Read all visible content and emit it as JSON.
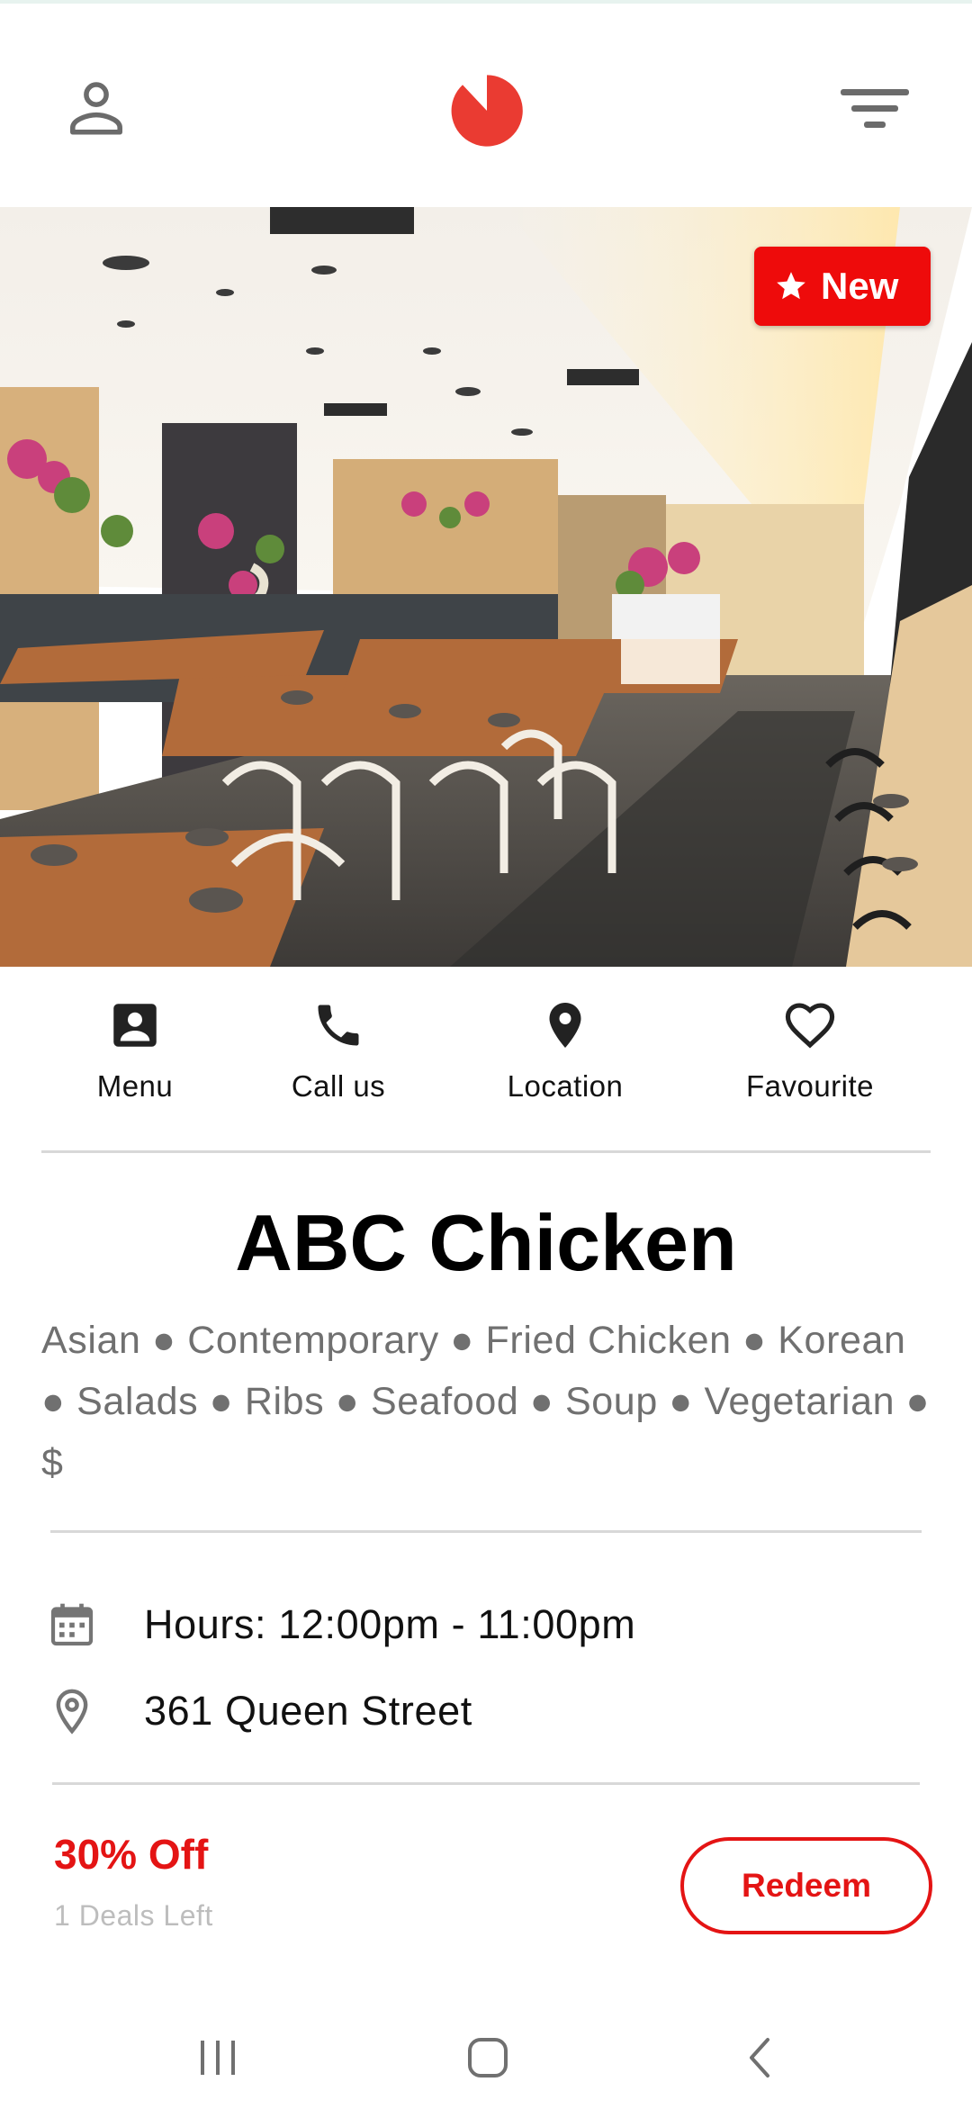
{
  "header": {
    "profile_icon": "person-outline-icon",
    "logo_icon": "pie-logo",
    "filter_icon": "filter-lines-icon",
    "brand_color": "#ea3b32"
  },
  "hero": {
    "image": "restaurant-interior-photo",
    "badge_label": "New",
    "badge_icon": "star-icon",
    "badge_color": "#ee0b0b"
  },
  "actions": [
    {
      "label": "Menu",
      "icon": "contact-card-icon"
    },
    {
      "label": "Call us",
      "icon": "phone-icon"
    },
    {
      "label": "Location",
      "icon": "location-pin-icon"
    },
    {
      "label": "Favourite",
      "icon": "heart-outline-icon"
    }
  ],
  "restaurant": {
    "name": "ABC Chicken",
    "cuisines": "Asian ● Contemporary ● Fried Chicken ● Korean ● Salads ● Ribs ● Seafood ● Soup ● Vegetarian ● $"
  },
  "info": {
    "hours": "Hours: 12:00pm - 11:00pm",
    "address": "361 Queen Street"
  },
  "deal": {
    "title": "30% Off",
    "subtitle": "1 Deals Left",
    "redeem_label": "Redeem",
    "accent": "#e41414"
  },
  "system_nav": {
    "recents_icon": "recents-icon",
    "home_icon": "home-icon",
    "back_icon": "back-icon"
  }
}
